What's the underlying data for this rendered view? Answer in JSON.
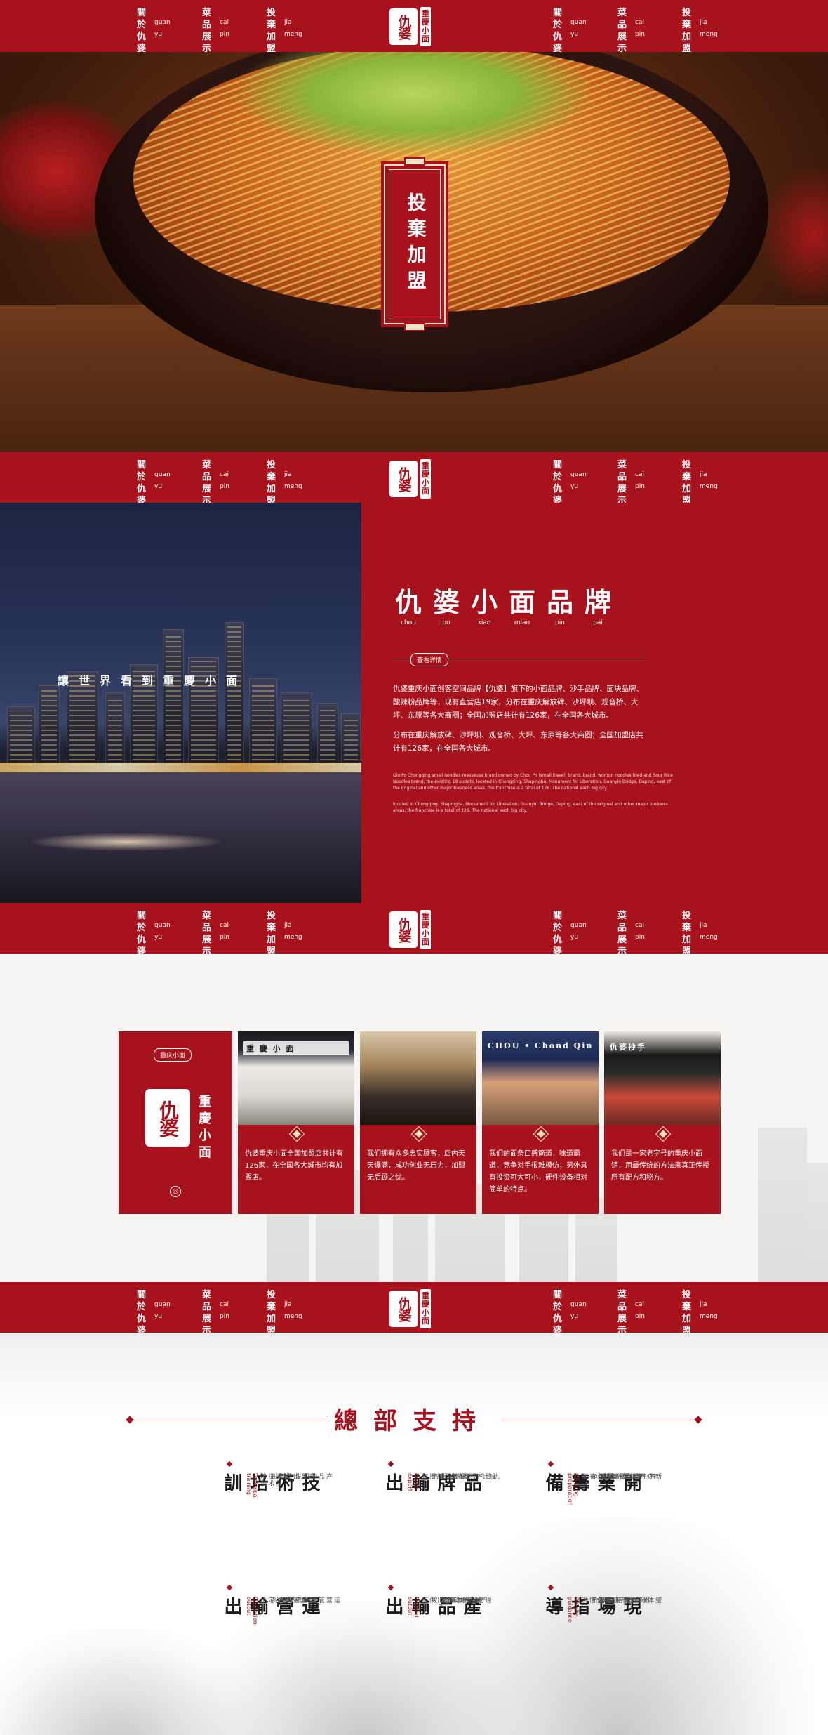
{
  "nav": {
    "left": [
      {
        "chars": [
          "關",
          "於",
          "仇",
          "婆"
        ],
        "pinyin": [
          "guan",
          "yu"
        ]
      },
      {
        "chars": [
          "菜",
          "品",
          "展",
          "示"
        ],
        "pinyin": [
          "cai",
          "pin"
        ]
      },
      {
        "chars": [
          "投",
          "棄",
          "加",
          "盟"
        ],
        "pinyin": [
          "jia",
          "meng"
        ]
      }
    ],
    "right": [
      {
        "chars": [
          "關",
          "於",
          "仇",
          "婆"
        ],
        "pinyin": [
          "guan",
          "yu"
        ]
      },
      {
        "chars": [
          "菜",
          "品",
          "展",
          "示"
        ],
        "pinyin": [
          "cai",
          "pin"
        ]
      },
      {
        "chars": [
          "投",
          "棄",
          "加",
          "盟"
        ],
        "pinyin": [
          "jia",
          "meng"
        ]
      }
    ],
    "logo": {
      "main": "仇婆",
      "side": [
        "重",
        "慶",
        "小",
        "面"
      ]
    }
  },
  "hero": {
    "badge": "投棄加盟"
  },
  "brand": {
    "slogan": "讓世界看到重慶小面",
    "title": [
      {
        "c": "仇",
        "p": "chou"
      },
      {
        "c": "婆",
        "p": "po"
      },
      {
        "c": "小",
        "p": "xiao"
      },
      {
        "c": "面",
        "p": "mian"
      },
      {
        "c": "品",
        "p": "pin"
      },
      {
        "c": "牌",
        "p": "pai"
      }
    ],
    "tag": "查看详情",
    "para1": "仇婆重庆小面创客空间品牌【仇婆】旗下的小面品牌、沙手品牌、面块品牌、酸辣粉品牌等，现有直营店19家，分布在重庆解放碑、沙坪坝、观音桥、大坪、东原等各大商圈；全国加盟店共计有126家，在全国各大城市。",
    "para2": "分布在重庆解放碑、沙坪坝、观音桥、大坪、东原等各大商圈；全国加盟店共计有126家，在全国各大城市。",
    "en1": "Qiu Po Chongqing small noodles masseuse brand owned by Chou Po (small travel) brand, brand, wonton noodles fried and Sour Rice Noodles brand, the existing 19 outlets, located in Chongqing, Shapingba, Monument for Liberation, Guanyin Bridge, Daping, east of the original and other major business areas, the franchise is a total of 126. The national each big city.",
    "en2": "located in Chongqing, Shapingba, Monument for Liberation, Guanyin Bridge, Daping, east of the original and other major business areas, the franchise is a total of 126. The national each big city."
  },
  "stores": {
    "intro": {
      "tag": "重庆小面",
      "logo": "仇婆",
      "side": "重慶小面"
    },
    "cards": [
      {
        "sign": "重 慶 小 面",
        "text": "仇婆重庆小面全国加盟店共计有126家，在全国各大城市均有加盟店。"
      },
      {
        "sign": "",
        "text": "我们拥有众多忠实顾客，店内天天爆满，成功创业无压力，加盟无后顾之忧。"
      },
      {
        "sign": "CHOU • Chond Qing Noodles",
        "text": "我们的面条口感筋道，味道霸道，竞争对手很难模仿；另外具有投资可大可小，硬件设备相对简单的特点。"
      },
      {
        "sign": "仇婆抄手",
        "text": "我们是一家老字号的重庆小面馆，用最传统的方法来真正传授所有配方和秘方。"
      }
    ]
  },
  "support": {
    "title": [
      "總",
      "部",
      "支",
      "持"
    ],
    "blocks": [
      {
        "head": "技術培訓",
        "en": "Technical training",
        "cols": [
          "料、抓员技术培训",
          "产品出品标准",
          "产品的研发定制"
        ]
      },
      {
        "head": "品牌輸出",
        "en": "Brand export",
        "cols": [
          "仇婆品牌授权",
          "仇婆VI视觉识别系统",
          "装修设计",
          "设计开店服务"
        ]
      },
      {
        "head": "開業籌備",
        "en": "Opening preparation",
        "cols": [
          "新店选址开业布面",
          "新店配物采清单",
          "新店产品执行标准",
          "开业广告物料"
        ]
      },
      {
        "head": "運營輸出",
        "en": "Operation output",
        "cols": [
          "市场及产品定位",
          "运营管理培训",
          "运营管理系统应用"
        ]
      },
      {
        "head": "產品輸出",
        "en": "Product output",
        "cols": [
          "核心原料输出/供应",
          "原材料的选择建议",
          "产品成本核算"
        ]
      },
      {
        "head": "現場指導",
        "en": "On-site guidance",
        "cols": [
          "跟踪督开业筹备情况",
          "协调采购鲜货",
          "整体分析前店情况"
        ]
      }
    ]
  }
}
